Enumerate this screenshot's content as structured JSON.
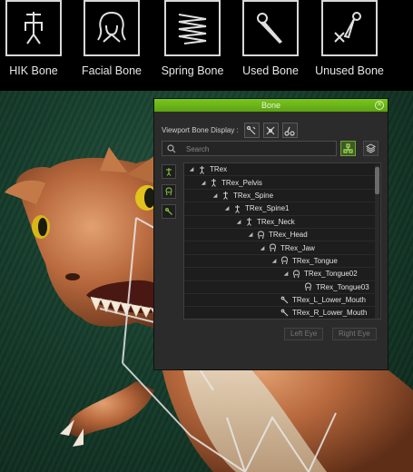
{
  "legend": [
    {
      "label": "HIK Bone",
      "icon": "hik-bone-icon"
    },
    {
      "label": "Facial Bone",
      "icon": "facial-bone-icon"
    },
    {
      "label": "Spring Bone",
      "icon": "spring-bone-icon"
    },
    {
      "label": "Used Bone",
      "icon": "used-bone-icon"
    },
    {
      "label": "Unused Bone",
      "icon": "unused-bone-icon"
    }
  ],
  "panel": {
    "title": "Bone",
    "viewport_display_label": "Viewport Bone Display :",
    "search_placeholder": "Search",
    "left_eye_label": "Left Eye",
    "right_eye_label": "Right Eye",
    "accent_color": "#6ab31a",
    "tree": [
      {
        "name": "TRex",
        "depth": 0,
        "expanded": true,
        "icon": "hik-bone-icon"
      },
      {
        "name": "TRex_Pelvis",
        "depth": 1,
        "expanded": true,
        "icon": "hik-bone-icon"
      },
      {
        "name": "TRex_Spine",
        "depth": 2,
        "expanded": true,
        "icon": "hik-bone-icon"
      },
      {
        "name": "TRex_Spine1",
        "depth": 3,
        "expanded": true,
        "icon": "hik-bone-icon"
      },
      {
        "name": "TRex_Neck",
        "depth": 4,
        "expanded": true,
        "icon": "hik-bone-icon"
      },
      {
        "name": "TRex_Head",
        "depth": 5,
        "expanded": true,
        "icon": "facial-bone-icon"
      },
      {
        "name": "TRex_Jaw",
        "depth": 6,
        "expanded": true,
        "icon": "facial-bone-icon"
      },
      {
        "name": "TRex_Tongue",
        "depth": 7,
        "expanded": true,
        "icon": "facial-bone-icon"
      },
      {
        "name": "TRex_Tongue02",
        "depth": 8,
        "expanded": true,
        "icon": "facial-bone-icon"
      },
      {
        "name": "TRex_Tongue03",
        "depth": 9,
        "expanded": false,
        "icon": "facial-bone-icon"
      },
      {
        "name": "TRex_L_Lower_Mouth",
        "depth": 7,
        "expanded": false,
        "icon": "used-bone-icon"
      },
      {
        "name": "TRex_R_Lower_Mouth",
        "depth": 7,
        "expanded": false,
        "icon": "used-bone-icon"
      }
    ]
  }
}
